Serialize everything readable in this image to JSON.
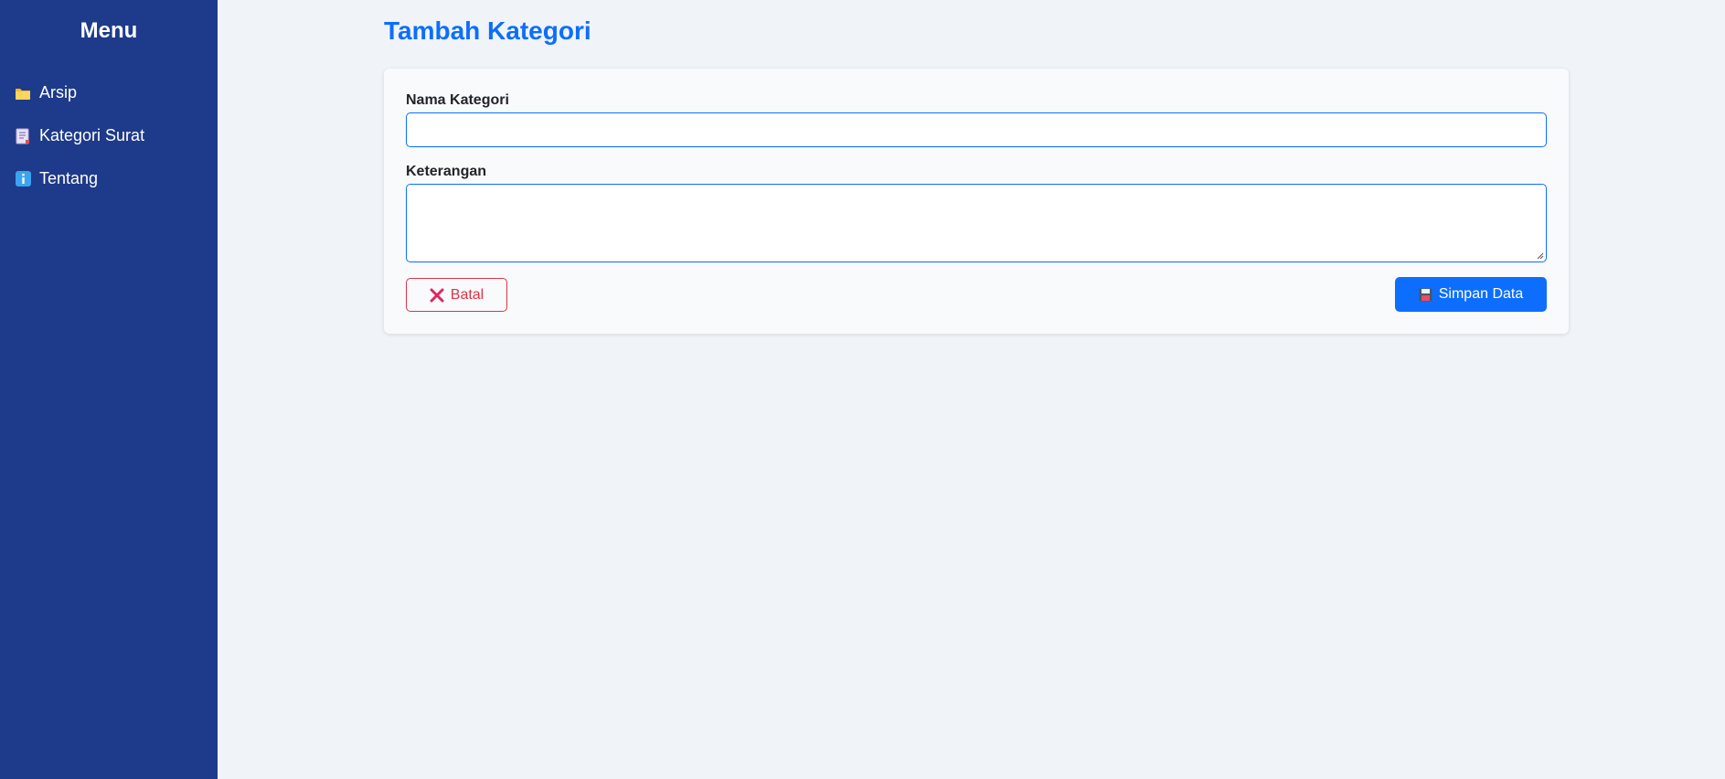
{
  "sidebar": {
    "title": "Menu",
    "items": [
      {
        "label": "Arsip",
        "icon": "folder-icon"
      },
      {
        "label": "Kategori Surat",
        "icon": "document-icon"
      },
      {
        "label": "Tentang",
        "icon": "info-icon"
      }
    ]
  },
  "page": {
    "title": "Tambah Kategori"
  },
  "form": {
    "name_label": "Nama Kategori",
    "name_value": "",
    "description_label": "Keterangan",
    "description_value": "",
    "cancel_label": "Batal",
    "save_label": "Simpan Data"
  },
  "colors": {
    "sidebar_bg": "#1e3a8a",
    "primary": "#0d6efd",
    "danger": "#dc3545",
    "page_bg": "#f0f4f8"
  }
}
